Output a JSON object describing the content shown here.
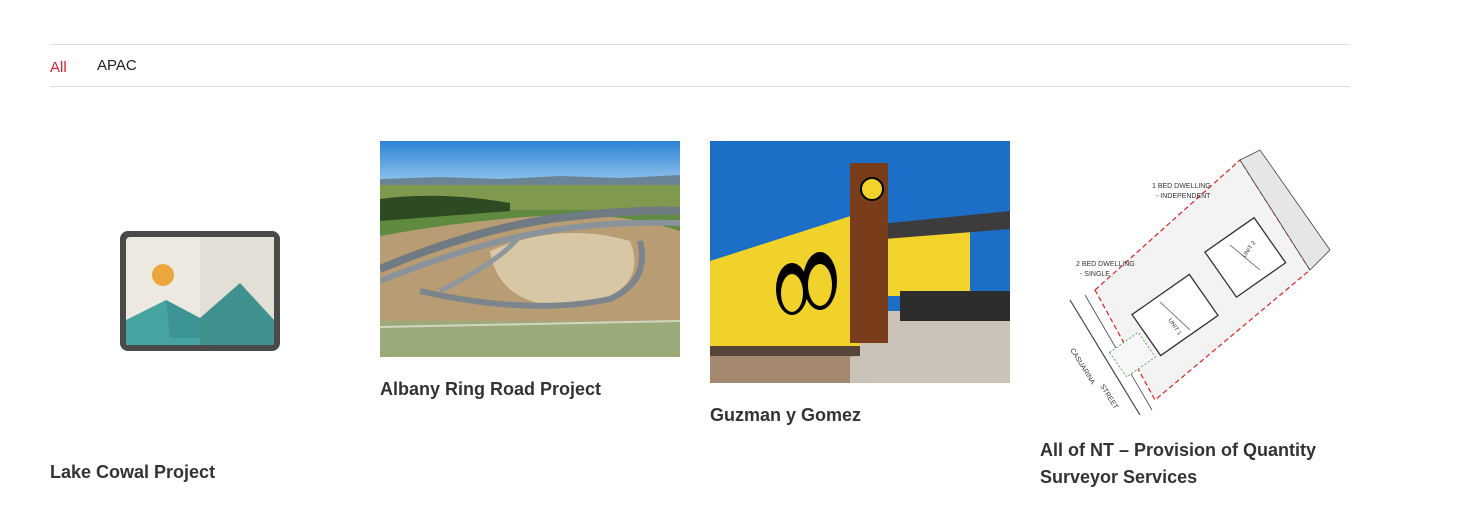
{
  "filters": [
    {
      "label": "All",
      "active": true
    },
    {
      "label": "APAC",
      "active": false
    }
  ],
  "colors": {
    "accent": "#d41e2a",
    "text": "#333333",
    "divider": "#dedede"
  },
  "projects": [
    {
      "title": "Lake Cowal Project",
      "thumbnail": "placeholder-image-icon"
    },
    {
      "title": "Albany Ring Road Project",
      "thumbnail": "aerial-road-interchange-photo"
    },
    {
      "title": "Guzman y Gomez",
      "thumbnail": "yellow-restaurant-building-photo"
    },
    {
      "title": "All of NT – Provision of Quantity Surveyor Services",
      "thumbnail": "site-plan-drawing"
    }
  ],
  "site_plan": {
    "labels": [
      "1 BED DWELLING",
      "- INDEPENDENT",
      "2 BED DWELLING",
      "- SINGLE",
      "UNIT 2",
      "UNIT 1",
      "CASUARINA",
      "STREET"
    ]
  }
}
